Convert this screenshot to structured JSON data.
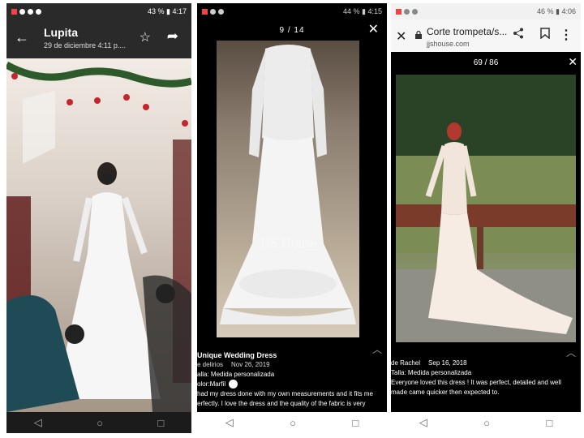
{
  "phone1": {
    "status": {
      "left": "……",
      "right": "43 % ▮ 4:17"
    },
    "header": {
      "back_icon": "←",
      "name": "Lupita",
      "date": "29 de diciembre 4:11 p....",
      "star_icon": "☆",
      "share_icon": "➦"
    },
    "nav": {
      "back": "◁",
      "home": "○",
      "recents": "□"
    }
  },
  "phone2": {
    "status": {
      "right": "44 % ▮ 4:15"
    },
    "counter": "9 / 14",
    "close_icon": "✕",
    "watermark": "JJS House",
    "review": {
      "title": "Unique Wedding Dress",
      "author": "e delirios",
      "date": "Nov 26, 2019",
      "size": "alla: Medida personalizada",
      "color_label": "olor:Marfil",
      "body": "had my dress done with my own measurements and it fits me erfectly. I love the dress and the quality of the fabric is very"
    },
    "nav": {
      "back": "◁",
      "home": "○",
      "recents": "□"
    }
  },
  "phone3": {
    "status": {
      "right": "46 % ▮ 4:06"
    },
    "header": {
      "close_icon": "✕",
      "lock_icon": "🔒",
      "title": "Corte trompeta/s...",
      "url": "jjshouse.com",
      "share_icon": "⮂",
      "bookmark_icon": "▯",
      "more_icon": "⋮"
    },
    "counter": "69 / 86",
    "close_icon": "✕",
    "review": {
      "author": "de Rachel",
      "date": "Sep 16, 2018",
      "size": "Talla: Medida personalizada",
      "body": "Everyone loved this dress ! It was perfect, detailed and well made came quicker then expected to."
    },
    "nav": {
      "back": "◁",
      "home": "○",
      "recents": "□"
    }
  }
}
